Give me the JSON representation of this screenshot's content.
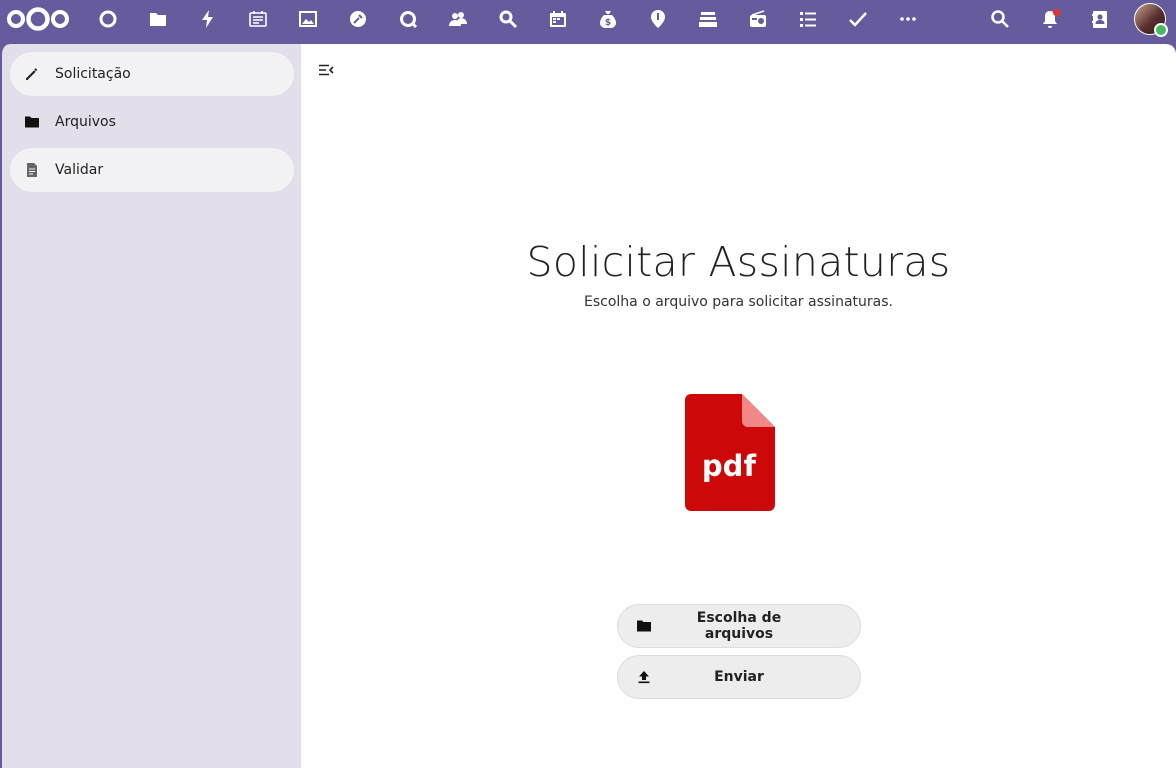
{
  "header": {
    "apps": [
      {
        "icon": "dashboard-icon"
      },
      {
        "icon": "files-icon"
      },
      {
        "icon": "activity-icon"
      },
      {
        "icon": "notes-icon"
      },
      {
        "icon": "photos-icon"
      },
      {
        "icon": "tools-icon"
      },
      {
        "icon": "talk-icon"
      },
      {
        "icon": "contacts-group-icon"
      },
      {
        "icon": "search-people-icon"
      },
      {
        "icon": "calendar-icon"
      },
      {
        "icon": "money-icon"
      },
      {
        "icon": "maps-icon"
      },
      {
        "icon": "deck-icon"
      },
      {
        "icon": "radio-icon"
      },
      {
        "icon": "list-icon"
      },
      {
        "icon": "tasks-icon"
      },
      {
        "icon": "more-apps-icon"
      }
    ],
    "right_icons": [
      "search-icon",
      "notifications-icon",
      "contacts-icon"
    ],
    "brand_color": "#665b9c",
    "notification_dot_color": "#e9322d",
    "status_color": "#46ba61"
  },
  "sidebar": {
    "items": [
      {
        "label": "Solicitação",
        "icon": "pencil-icon"
      },
      {
        "label": "Arquivos",
        "icon": "folder-icon"
      },
      {
        "label": "Validar",
        "icon": "document-icon"
      }
    ]
  },
  "main": {
    "title": "Solicitar Assinaturas",
    "subtitle": "Escolha o arquivo para solicitar assinaturas.",
    "pdf_label": "pdf",
    "buttons": {
      "choose": "Escolha de arquivos",
      "upload": "Enviar"
    },
    "pdf_color": "#cc0808"
  }
}
